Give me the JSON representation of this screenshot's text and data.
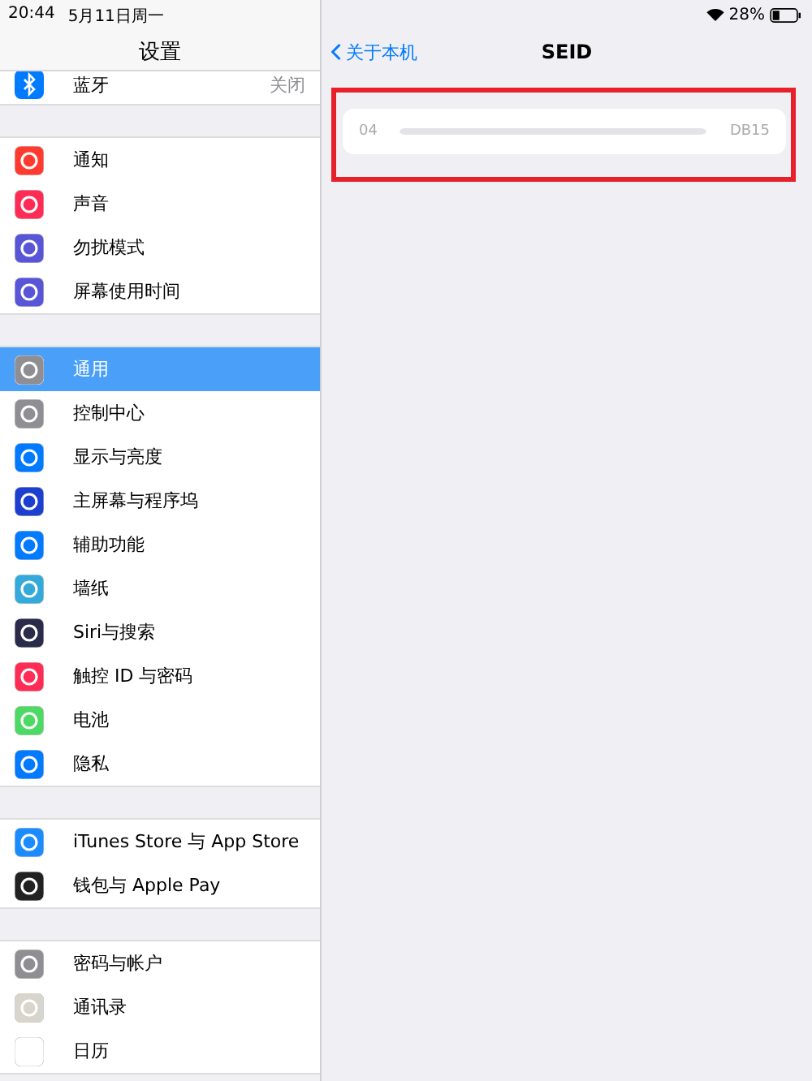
{
  "status_bar": {
    "time": "20:44",
    "date": "5月11日周一",
    "battery": "28%"
  },
  "sidebar": {
    "title": "设置",
    "partial_row": {
      "label": "蓝牙",
      "value": "关闭"
    },
    "groups": [
      [
        {
          "label": "通知",
          "selected": false
        },
        {
          "label": "声音",
          "selected": false
        },
        {
          "label": "勿扰模式",
          "selected": false
        },
        {
          "label": "屏幕使用时间",
          "selected": false
        }
      ],
      [
        {
          "label": "通用",
          "selected": true
        },
        {
          "label": "控制中心",
          "selected": false
        },
        {
          "label": "显示与亮度",
          "selected": false
        },
        {
          "label": "主屏幕与程序坞",
          "selected": false
        },
        {
          "label": "辅助功能",
          "selected": false
        },
        {
          "label": "墙纸",
          "selected": false
        },
        {
          "label": "Siri与搜索",
          "selected": false
        },
        {
          "label": "触控 ID 与密码",
          "selected": false
        },
        {
          "label": "电池",
          "selected": false
        },
        {
          "label": "隐私",
          "selected": false
        }
      ],
      [
        {
          "label": "iTunes Store 与 App Store",
          "selected": false
        },
        {
          "label": "钱包与 Apple Pay",
          "selected": false
        }
      ],
      [
        {
          "label": "密码与帐户",
          "selected": false
        },
        {
          "label": "通讯录",
          "selected": false
        },
        {
          "label": "日历",
          "selected": false
        }
      ]
    ]
  },
  "detail": {
    "back": "关于本机",
    "title": "SEID",
    "seid_start": "04",
    "seid_end": "DB15"
  }
}
